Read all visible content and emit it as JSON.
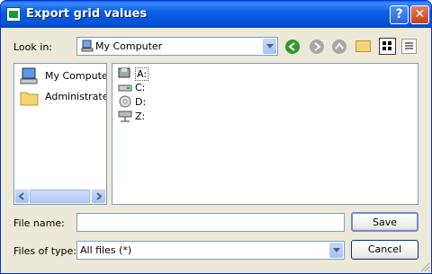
{
  "window": {
    "title": "Export grid values"
  },
  "lookin": {
    "label": "Look in:",
    "value": "My Computer"
  },
  "places": [
    {
      "label": "My Computer"
    },
    {
      "label": "Administrateur"
    }
  ],
  "drives": [
    {
      "label": "A:"
    },
    {
      "label": "C:"
    },
    {
      "label": "D:"
    },
    {
      "label": "Z:"
    }
  ],
  "filename": {
    "label": "File name:",
    "value": ""
  },
  "filetype": {
    "label": "Files of type:",
    "value": "All files (*)"
  },
  "buttons": {
    "save": "Save",
    "cancel": "Cancel"
  }
}
